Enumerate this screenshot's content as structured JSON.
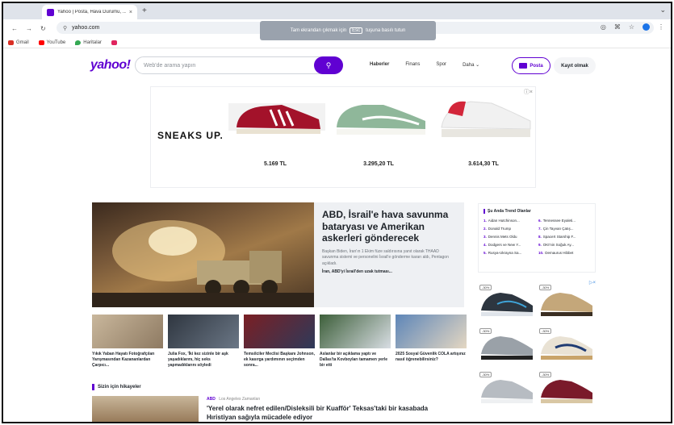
{
  "browser": {
    "tab_title": "Yahoo | Posta, Hava Durumu, ...",
    "tab_close": "×",
    "new_tab": "+",
    "url": "yahoo.com",
    "bookmarks": [
      {
        "label": "Gmail",
        "color": "#d93025"
      },
      {
        "label": "YouTube",
        "color": "#ff0000"
      },
      {
        "label": "Haritalar",
        "color": "#34a853"
      }
    ],
    "toast": {
      "pre": "Tam ekrandan çıkmak için",
      "key": "Esc",
      "post": "tuşuna basılı tutun"
    }
  },
  "header": {
    "logo": "yahoo!",
    "search_placeholder": "Web'de arama yapın",
    "nav": [
      "Haberler",
      "Finans",
      "Spor",
      "Daha ⌄"
    ],
    "mail_label": "Posta",
    "signup_label": "Kayıt olmak"
  },
  "ad": {
    "brand": "SNEAKS UP.",
    "prices": [
      "5.169 TL",
      "3.295,20 TL",
      "3.614,30 TL"
    ]
  },
  "hero": {
    "title": "ABD, İsrail'e hava savunma bataryası ve Amerikan askerleri gönderecek",
    "desc": "Başkan Biden, İran'ın 1 Ekim füze saldırısına yanıt olarak THAAD savunma sistemi ve personelini İsrail'e gönderme kararı aldı, Pentagon açıkladı.",
    "link": "İran, ABD'yi İsrail'den uzak tutması..."
  },
  "stories": [
    "Yıkık Yaban Hayatı Fotoğrafçıları Yarışmasından Kazananlardan Çarpıcı...",
    "Julia Fox, 'İki kez sizinle bir aşk yaşadıklarını, hiç seks yapmadıklarını söyledi",
    "Temsilciler Meclisi Başkanı Johnson, ek kasırga yardımının seçimden sonra...",
    "Aslanlar bir açıklama yaptı ve Dallas'ta Kovboyları tamamen yerle bir etti",
    "2025 Sosyal Güvenlik COLA artışınız nasıl öğrenebilirsiniz?"
  ],
  "for_you": {
    "heading": "Sizin için hikayeler",
    "category": "ABD",
    "source": "Los Angeles Zamanları",
    "title": "'Yerel olarak nefret edilen/Disleksili bir Kuafför' Teksas'taki bir kasabada Hıristiyan sağıyla mücadele ediyor"
  },
  "trending": {
    "heading": "Şu Anda Trend Olanlar",
    "items": [
      {
        "n": "1.",
        "label": "Aidan Hutchinson..."
      },
      {
        "n": "6.",
        "label": "Tennessee Eyaleti..."
      },
      {
        "n": "2.",
        "label": "Donald Trump"
      },
      {
        "n": "7.",
        "label": "Çin Tayvan Çatış..."
      },
      {
        "n": "3.",
        "label": "Dennis Mets Oldu"
      },
      {
        "n": "8.",
        "label": "SpaceX Starship F..."
      },
      {
        "n": "4.",
        "label": "Dodgers ve New Y..."
      },
      {
        "n": "9.",
        "label": "OKI'nin Soğuk Ay..."
      },
      {
        "n": "5.",
        "label": "Rusya-Ukrayna Sa..."
      },
      {
        "n": "10.",
        "label": "Demaurus Hibbet"
      }
    ]
  },
  "side_ad": {
    "badge": "-30%",
    "close": "▷×"
  }
}
